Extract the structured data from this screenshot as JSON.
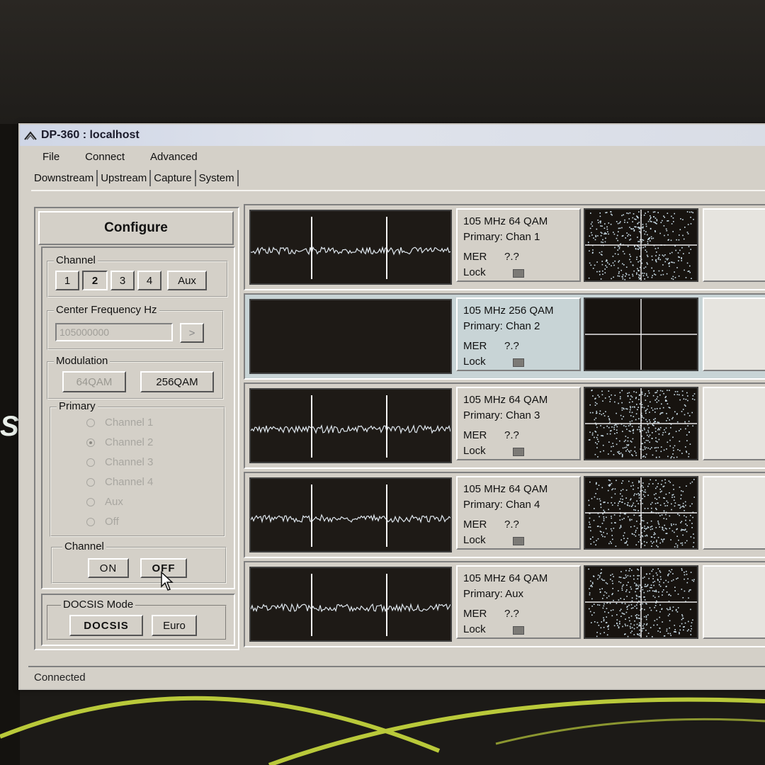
{
  "window": {
    "title": "DP-360 : localhost"
  },
  "menu": [
    "File",
    "Connect",
    "Advanced"
  ],
  "tabs": [
    "Downstream",
    "Upstream",
    "Capture",
    "System"
  ],
  "configure": {
    "header": "Configure",
    "channel_group": {
      "label": "Channel",
      "buttons": [
        "1",
        "2",
        "3",
        "4",
        "Aux"
      ],
      "selected": "2"
    },
    "center_frequency": {
      "label": "Center Frequency Hz",
      "value": "105000000",
      "go_button": ">"
    },
    "modulation": {
      "label": "Modulation",
      "options": [
        "64QAM",
        "256QAM"
      ],
      "selected": "256QAM"
    },
    "primary": {
      "label": "Primary",
      "options": [
        "Channel 1",
        "Channel 2",
        "Channel 3",
        "Channel 4",
        "Aux",
        "Off"
      ],
      "selected": "Channel 2"
    },
    "channel_power": {
      "label": "Channel",
      "on": "ON",
      "off": "OFF"
    },
    "docsis_mode": {
      "label": "DOCSIS Mode",
      "options": [
        "DOCSIS",
        "Euro"
      ]
    }
  },
  "rows": [
    {
      "freq": "105 MHz",
      "mod": "64 QAM",
      "primary": "Primary: Chan 1",
      "mer_label": "MER",
      "mer": "?.?",
      "lock_label": "Lock",
      "signal": true
    },
    {
      "freq": "105 MHz",
      "mod": "256 QAM",
      "primary": "Primary: Chan 2",
      "mer_label": "MER",
      "mer": "?.?",
      "lock_label": "Lock",
      "signal": false
    },
    {
      "freq": "105 MHz",
      "mod": "64 QAM",
      "primary": "Primary: Chan 3",
      "mer_label": "MER",
      "mer": "?.?",
      "lock_label": "Lock",
      "signal": true
    },
    {
      "freq": "105 MHz",
      "mod": "64 QAM",
      "primary": "Primary: Chan 4",
      "mer_label": "MER",
      "mer": "?.?",
      "lock_label": "Lock",
      "signal": true
    },
    {
      "freq": "105 MHz",
      "mod": "64 QAM",
      "primary": "Primary: Aux",
      "mer_label": "MER",
      "mer": "?.?",
      "lock_label": "Lock",
      "signal": true
    }
  ],
  "status": "Connected",
  "colors": {
    "trace": "#dfe7ee",
    "plot_bg": "#1e1a16",
    "swoosh": "#b9c93a"
  }
}
